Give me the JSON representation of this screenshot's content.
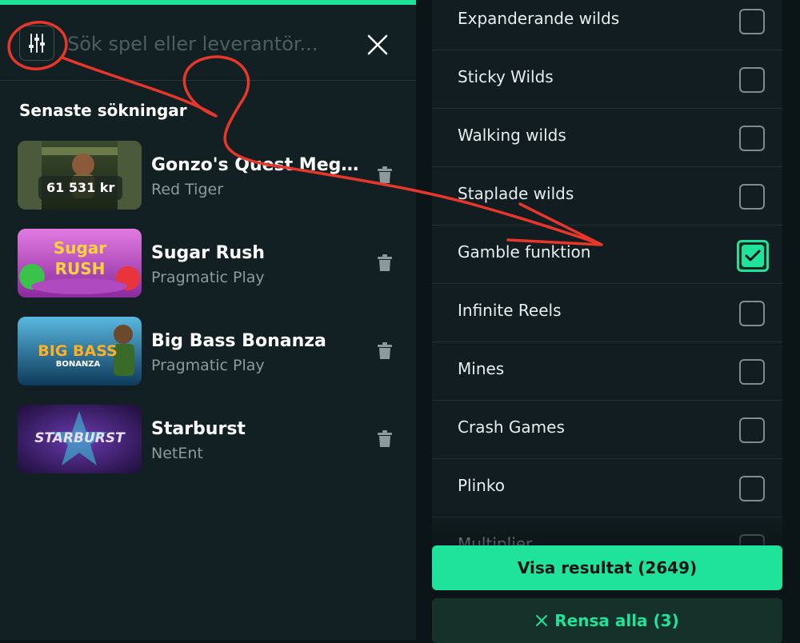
{
  "search": {
    "placeholder": "Sök spel eller leverantör..."
  },
  "recent": {
    "title": "Senaste sökningar",
    "items": [
      {
        "title": "Gonzo's Quest Mega...",
        "provider": "Red Tiger",
        "badge": "61 531 kr"
      },
      {
        "title": "Sugar Rush",
        "provider": "Pragmatic Play",
        "thumb_text_1": "Sugar",
        "thumb_text_2": "RUSH"
      },
      {
        "title": "Big Bass Bonanza",
        "provider": "Pragmatic Play",
        "thumb_text_1": "BIG BASS",
        "thumb_text_2": "BONANZA"
      },
      {
        "title": "Starburst",
        "provider": "NetEnt",
        "thumb_text_1": "STARBURST"
      }
    ]
  },
  "features": [
    {
      "label": "Expanderande wilds",
      "checked": false
    },
    {
      "label": "Sticky Wilds",
      "checked": false
    },
    {
      "label": "Walking wilds",
      "checked": false
    },
    {
      "label": "Staplade wilds",
      "checked": false
    },
    {
      "label": "Gamble funktion",
      "checked": true
    },
    {
      "label": "Infinite Reels",
      "checked": false
    },
    {
      "label": "Mines",
      "checked": false
    },
    {
      "label": "Crash Games",
      "checked": false
    },
    {
      "label": "Plinko",
      "checked": false
    },
    {
      "label": "Multiplier",
      "checked": false
    }
  ],
  "buttons": {
    "show_results": "Visa resultat (2649)",
    "clear_all": "Rensa alla (3)"
  },
  "colors": {
    "accent": "#1fe39a",
    "annotation": "#e8362a"
  },
  "icons": {
    "filter": "sliders-icon",
    "close": "close-icon",
    "delete": "trash-icon",
    "check": "checkmark-icon",
    "clear": "x-icon"
  }
}
